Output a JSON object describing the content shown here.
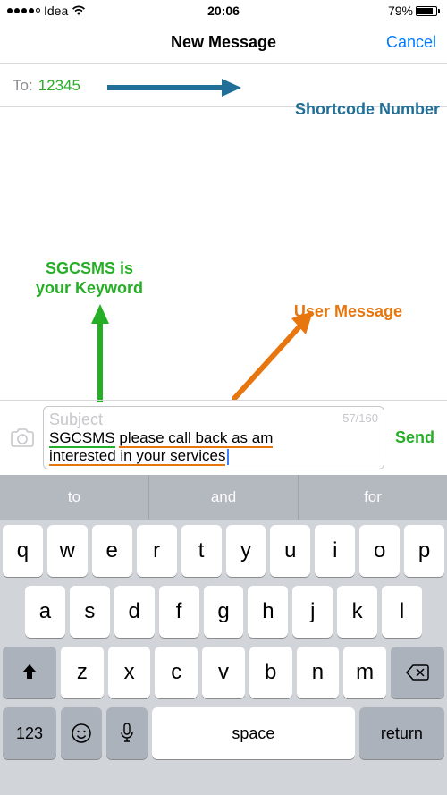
{
  "status": {
    "carrier": "Idea",
    "time": "20:06",
    "battery_pct": "79%"
  },
  "nav": {
    "title": "New Message",
    "cancel": "Cancel"
  },
  "to": {
    "label": "To:",
    "number": "12345"
  },
  "annotations": {
    "shortcode": "Shortcode Number",
    "keyword_l1": "SGCSMS is",
    "keyword_l2": "your Keyword",
    "usermsg": "User Message"
  },
  "compose": {
    "subject_placeholder": "Subject",
    "char_count": "57/160",
    "keyword": "SGCSMS",
    "message_part1": "please call back as am",
    "message_part2": "interested in your services",
    "send": "Send"
  },
  "suggestions": [
    "to",
    "and",
    "for"
  ],
  "keys": {
    "row1": [
      "q",
      "w",
      "e",
      "r",
      "t",
      "y",
      "u",
      "i",
      "o",
      "p"
    ],
    "row2": [
      "a",
      "s",
      "d",
      "f",
      "g",
      "h",
      "j",
      "k",
      "l"
    ],
    "row3": [
      "z",
      "x",
      "c",
      "v",
      "b",
      "n",
      "m"
    ],
    "numbers": "123",
    "space": "space",
    "return": "return"
  }
}
